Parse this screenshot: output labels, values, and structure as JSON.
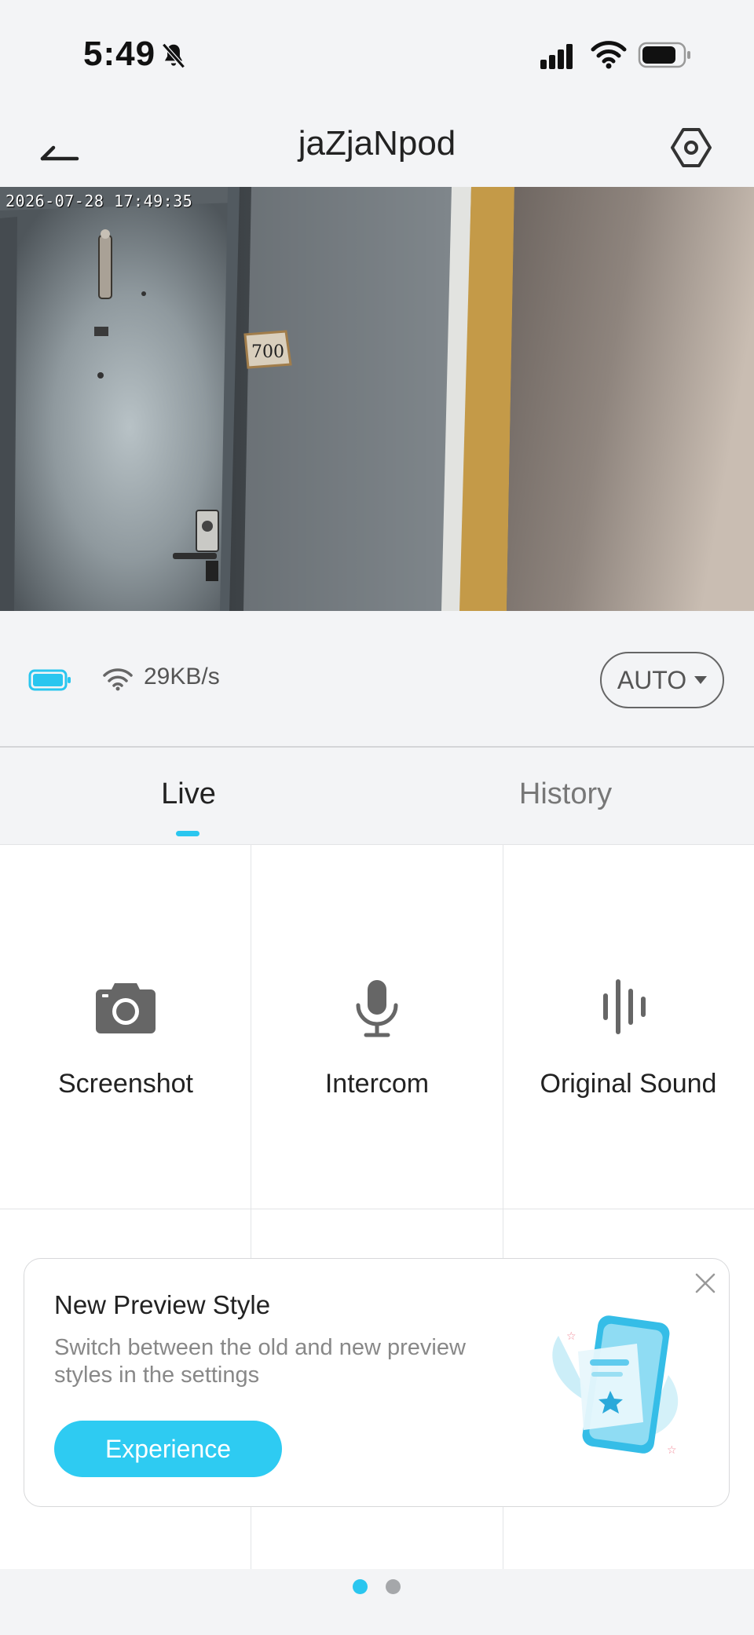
{
  "status_bar": {
    "time": "5:49"
  },
  "header": {
    "title": "jaZjaNpod"
  },
  "video": {
    "timestamp": "2026-07-28 17:49:35",
    "door_number": "700"
  },
  "info": {
    "bitrate": "29KB/s",
    "quality_label": "AUTO"
  },
  "tabs": [
    {
      "label": "Live",
      "active": true
    },
    {
      "label": "History",
      "active": false
    }
  ],
  "actions": [
    {
      "label": "Screenshot",
      "icon": "camera-icon"
    },
    {
      "label": "Intercom",
      "icon": "microphone-icon"
    },
    {
      "label": "Original Sound",
      "icon": "sound-wave-icon"
    }
  ],
  "popup": {
    "title": "New Preview Style",
    "text": "Switch between the old and new preview styles in the settings",
    "button_label": "Experience"
  },
  "pager": {
    "current_page": 1,
    "total_pages": 2
  },
  "colors": {
    "accent": "#2ac6ef",
    "background": "#f3f4f6"
  }
}
